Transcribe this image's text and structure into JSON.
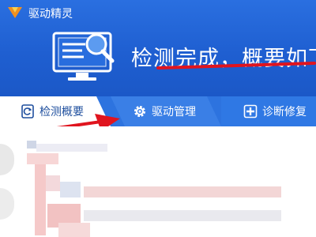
{
  "app": {
    "title": "驱动精灵"
  },
  "header": {
    "headline": "检测完成，概要如下"
  },
  "tabs": [
    {
      "label": "检测概要",
      "icon": "refresh-doc-icon",
      "active": true
    },
    {
      "label": "驱动管理",
      "icon": "gear-icon",
      "active": false
    },
    {
      "label": "诊断修复",
      "icon": "diagnose-icon",
      "active": false
    }
  ],
  "colors": {
    "header_blue": "#1f5fd1",
    "annotation_red": "#e0141e"
  }
}
